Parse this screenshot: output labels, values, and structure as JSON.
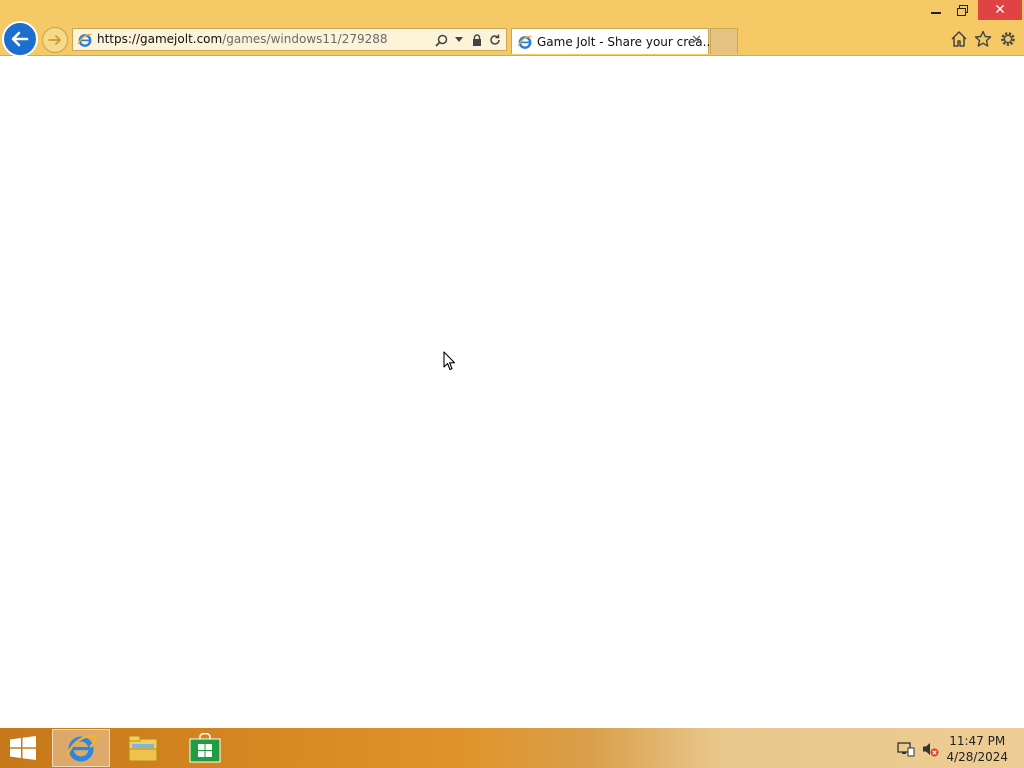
{
  "window": {
    "minimize_icon": "minimize-icon",
    "restore_icon": "restore-icon",
    "close_glyph": "✕"
  },
  "nav": {
    "back_icon": "back-arrow-icon",
    "forward_icon": "forward-arrow-icon"
  },
  "address_bar": {
    "url_scheme_host": "https://gamejolt.com",
    "url_path": "/games/windows11/279288",
    "icons": [
      "search-icon",
      "dropdown-icon",
      "lock-icon",
      "refresh-icon"
    ]
  },
  "tabs": [
    {
      "title": "Game Jolt - Share your crea...",
      "active": true,
      "close_glyph": "✕"
    }
  ],
  "toolbar": {
    "icons": [
      "home-icon",
      "favorites-star-icon",
      "settings-gear-icon"
    ]
  },
  "taskbar": {
    "apps": [
      "internet-explorer-icon",
      "file-explorer-icon",
      "store-icon"
    ],
    "tray_icons": [
      "network-icon",
      "volume-muted-icon"
    ],
    "clock": {
      "time": "11:47 PM",
      "date": "4/28/2024"
    }
  },
  "colors": {
    "chrome": "#f4c966",
    "accent": "#1a6fd0",
    "close": "#e04343"
  }
}
